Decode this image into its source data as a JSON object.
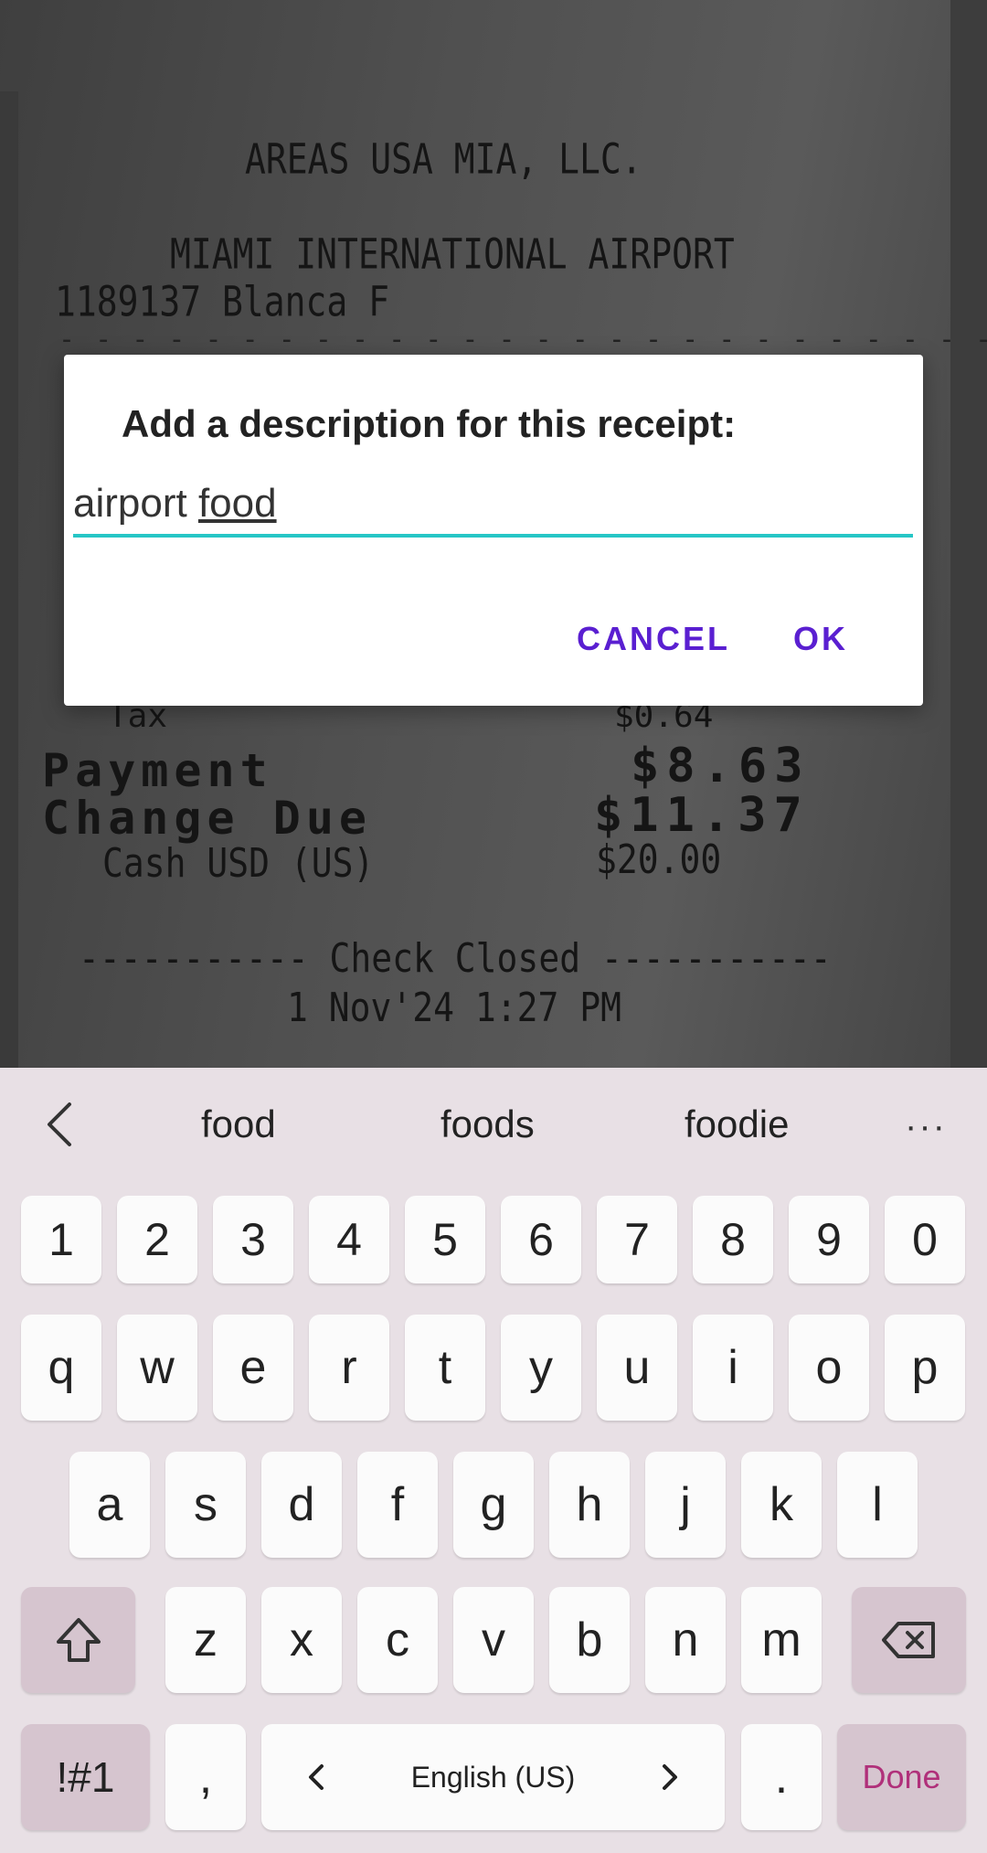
{
  "receipt": {
    "merchant": "AREAS USA MIA, LLC.",
    "airport": "MIAMI INTERNATIONAL AIRPORT",
    "server": "1189137 Blanca F",
    "tax_label": "Tax",
    "tax_value": "$0.64",
    "payment_label": "Payment",
    "payment_value": "$8.63",
    "change_label": "Change Due",
    "change_value": "$11.37",
    "cash_label": "Cash USD (US)",
    "cash_value": "$20.00",
    "check_closed": "----------- Check Closed -----------",
    "datetime": "1 Nov'24 1:27 PM"
  },
  "dialog": {
    "title": "Add a description for this receipt:",
    "input_value_part1": "airport ",
    "input_value_part2": "food",
    "cancel_label": "CANCEL",
    "ok_label": "OK",
    "accent_color": "#26c6c6",
    "button_color": "#5a1fd1"
  },
  "keyboard": {
    "suggestions": [
      "food",
      "foods",
      "foodie"
    ],
    "more_label": "···",
    "numbers": [
      "1",
      "2",
      "3",
      "4",
      "5",
      "6",
      "7",
      "8",
      "9",
      "0"
    ],
    "row1": [
      "q",
      "w",
      "e",
      "r",
      "t",
      "y",
      "u",
      "i",
      "o",
      "p"
    ],
    "row2": [
      "a",
      "s",
      "d",
      "f",
      "g",
      "h",
      "j",
      "k",
      "l"
    ],
    "row3": [
      "z",
      "x",
      "c",
      "v",
      "b",
      "n",
      "m"
    ],
    "symbols_label": "!#1",
    "comma_label": ",",
    "space_label": "English (US)",
    "period_label": ".",
    "done_label": "Done",
    "done_color": "#b0307a"
  }
}
